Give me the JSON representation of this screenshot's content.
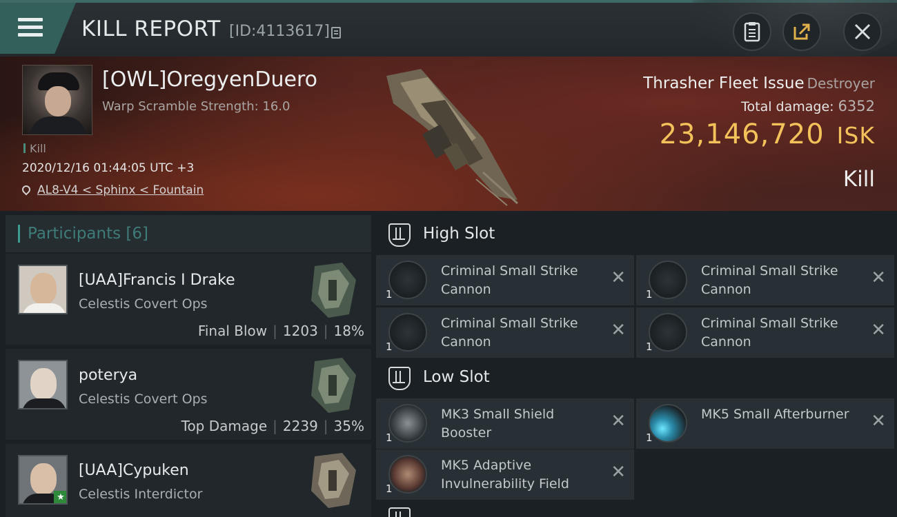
{
  "header": {
    "title": "KILL REPORT",
    "report_id": "[ID:4113617]",
    "menu_icon": "hamburger-menu-icon",
    "buttons": [
      {
        "icon": "clipboard-icon"
      },
      {
        "icon": "share-icon"
      },
      {
        "icon": "close-icon"
      }
    ]
  },
  "victim": {
    "name": "[OWL]OregyenDuero",
    "scramble": "Warp Scramble Strength: 16.0",
    "kill_tag": "Kill",
    "datetime": "2020/12/16 01:44:05 UTC +3",
    "location": "AL8-V4 < Sphinx < Fountain",
    "ship_name": "Thrasher Fleet Issue",
    "ship_class": "Destroyer",
    "total_damage_label": "Total damage:",
    "total_damage": "6352",
    "isk_value": "23,146,720",
    "isk_unit": "ISK",
    "result": "Kill"
  },
  "participants": {
    "label": "Participants [6]",
    "items": [
      {
        "name": "[UAA]Francis I Drake",
        "ship": "Celestis Covert Ops",
        "role": "Final Blow",
        "damage": "1203",
        "percent": "18%"
      },
      {
        "name": "poterya",
        "ship": "Celestis Covert Ops",
        "role": "Top Damage",
        "damage": "2239",
        "percent": "35%"
      },
      {
        "name": "[UAA]Cypuken",
        "ship": "Celestis Interdictor"
      }
    ]
  },
  "fitting": {
    "high_slot": {
      "label": "High Slot",
      "modules": [
        {
          "name": "Criminal Small Strike Cannon",
          "qty": "1"
        },
        {
          "name": "Criminal Small Strike Cannon",
          "qty": "1"
        },
        {
          "name": "Criminal Small Strike Cannon",
          "qty": "1"
        },
        {
          "name": "Criminal Small Strike Cannon",
          "qty": "1"
        }
      ]
    },
    "low_slot": {
      "label": "Low Slot",
      "modules": [
        {
          "name": "MK3 Small Shield Booster",
          "qty": "1"
        },
        {
          "name": "MK5 Small Afterburner",
          "qty": "1"
        },
        {
          "name": "MK5 Adaptive Invulnerability Field",
          "qty": "1"
        }
      ]
    },
    "remove_glyph": "✕"
  },
  "colors": {
    "accent_teal": "#33605b",
    "isk_gold": "#f3c25a",
    "participants_label": "#3d7c78"
  }
}
